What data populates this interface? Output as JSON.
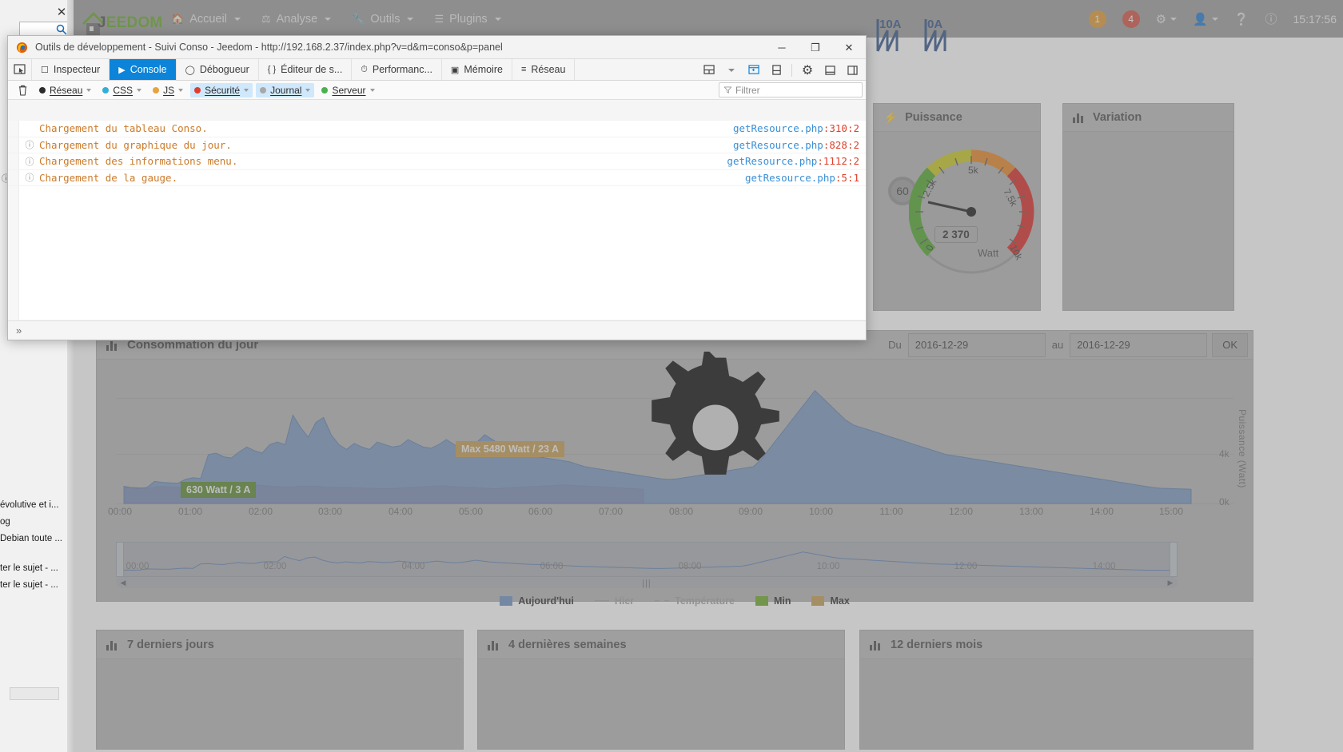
{
  "browser_left": {
    "tab_close_icon": "close-icon",
    "search_icon": "search-icon",
    "links": [
      "évolutive et i...",
      "og",
      "Debian toute ...",
      "",
      "ter le sujet - ...",
      "ter le sujet - ..."
    ]
  },
  "jeedom": {
    "logo": {
      "name": "jeedom-logo",
      "word1": "J",
      "word2": "EEDOM"
    },
    "nav": [
      {
        "label": "Accueil",
        "icon": "home-icon"
      },
      {
        "label": "Analyse",
        "icon": "analysis-icon"
      },
      {
        "label": "Outils",
        "icon": "wrench-icon"
      },
      {
        "label": "Plugins",
        "icon": "plugins-icon"
      }
    ],
    "nav_right": {
      "badge_orange": "1",
      "badge_red": "4",
      "gear_icon": "gear-icon",
      "user_icon": "user-icon",
      "help_icon": "question-icon",
      "info_icon": "info-icon",
      "clock": "15:17:56"
    },
    "breakers": [
      {
        "label": "10A",
        "name": "breaker-10a"
      },
      {
        "label": "0A",
        "name": "breaker-0a"
      }
    ],
    "widgets": [
      {
        "title": "Puissance",
        "icon": "bolt-icon"
      },
      {
        "title": "Variation",
        "icon": "chart-icon"
      }
    ],
    "gauge": {
      "badge": "60",
      "value": "2 370",
      "unit": "Watt",
      "ticks": [
        "0",
        "2.5k",
        "5k",
        "7.5k",
        "10k"
      ]
    },
    "conso_panel": {
      "title": "Consommation du jour",
      "icon": "chart-icon",
      "date_from_label": "Du",
      "date_from_value": "2016-12-29",
      "date_to_label": "au",
      "date_to_value": "2016-12-29",
      "ok_label": "OK"
    },
    "bottom_cards": [
      {
        "title": "7 derniers jours",
        "icon": "chart-icon"
      },
      {
        "title": "4 dernières semaines",
        "icon": "chart-icon"
      },
      {
        "title": "12 derniers mois",
        "icon": "chart-icon"
      }
    ],
    "gear_overlay_icon": "gear-icon"
  },
  "chart_data": {
    "type": "area",
    "title": "Consommation du jour",
    "xlabel": "",
    "ylabel": "Puissance (Watt)",
    "ylim": [
      0,
      5000
    ],
    "yticks": [
      0,
      4000
    ],
    "ytick_labels": [
      "0k",
      "4k"
    ],
    "xticks": [
      "00:00",
      "01:00",
      "02:00",
      "03:00",
      "04:00",
      "05:00",
      "06:00",
      "07:00",
      "08:00",
      "09:00",
      "10:00",
      "11:00",
      "12:00",
      "13:00",
      "14:00",
      "15:00"
    ],
    "grid": true,
    "legend_position": "bottom",
    "annotations": [
      {
        "name": "max-label",
        "text": "Max 5480 Watt / 23 A",
        "color": "#c49a4e"
      },
      {
        "name": "min-label",
        "text": "630 Watt / 3 A",
        "color": "#56862a"
      }
    ],
    "legend": [
      {
        "label": "Aujourd'hui",
        "marker": "swatch",
        "color": "#6c8ebf"
      },
      {
        "label": "Hier",
        "marker": "line",
        "color": "#9e9e9e"
      },
      {
        "label": "Température",
        "marker": "dash",
        "color": "#9e9e9e"
      },
      {
        "label": "Min",
        "marker": "swatch",
        "color": "#6aa621"
      },
      {
        "label": "Max",
        "marker": "swatch",
        "color": "#c49a4e"
      }
    ],
    "series": [
      {
        "name": "Aujourd'hui",
        "color": "#6c8ebf",
        "values": [
          700,
          640,
          620,
          650,
          900,
          860,
          840,
          820,
          980,
          1050,
          1020,
          1990,
          2050,
          1900,
          1850,
          2100,
          2300,
          2150,
          2050,
          2400,
          2500,
          2400,
          3600,
          3100,
          2700,
          3300,
          3500,
          2800,
          2400,
          2200,
          2450,
          2300,
          2200,
          2500,
          2400,
          2300,
          2350,
          2600,
          2450,
          2300,
          2250,
          2400,
          2600,
          2400,
          2250,
          2300,
          2500,
          2800,
          2600,
          2400,
          2300,
          2200,
          2100,
          2000,
          1900,
          1850,
          1800,
          1750,
          1700,
          1600,
          1500,
          1450,
          1400,
          1350,
          1300,
          1250,
          1200,
          1150,
          1100,
          1050,
          1000,
          980,
          1000,
          1050,
          1100,
          1150,
          1200,
          1250,
          1300,
          1350,
          1400,
          1450,
          1500,
          1800,
          2200,
          2600,
          3000,
          3400,
          3800,
          4200,
          4600,
          4300,
          4000,
          3700,
          3400,
          3200,
          3100,
          3000,
          2900,
          2800,
          2700,
          2600,
          2500,
          2400,
          2300,
          2200,
          2100,
          2000,
          1950,
          1900,
          1850,
          1800,
          1750,
          1700,
          1650,
          1600,
          1550,
          1500,
          1450,
          1400,
          1350,
          1300,
          1250,
          1200,
          1150,
          1100,
          1050,
          1000,
          950,
          900,
          850,
          800,
          750,
          700,
          650,
          620,
          610,
          600,
          590,
          580
        ]
      },
      {
        "name": "Hier",
        "color": "#a5504e",
        "values": [
          650,
          640,
          630,
          620,
          700,
          680,
          660,
          650,
          640,
          630,
          700,
          720,
          690,
          660,
          700,
          750,
          720,
          700,
          680,
          660,
          700,
          710,
          690,
          670,
          660,
          650,
          640,
          630,
          620,
          610,
          600,
          620,
          640,
          660,
          680,
          700,
          720,
          700,
          680,
          660,
          640,
          620,
          600,
          620,
          640,
          660,
          680,
          700,
          720,
          740,
          760,
          740,
          720,
          700,
          680,
          660,
          640,
          620,
          600,
          580
        ]
      }
    ],
    "navigator": {
      "xticks": [
        "00:00",
        "02:00",
        "04:00",
        "06:00",
        "08:00",
        "10:00",
        "12:00",
        "14:00"
      ]
    }
  },
  "devtools": {
    "window": {
      "title": "Outils de développement - Suivi Conso - Jeedom - http://192.168.2.37/index.php?v=d&m=conso&p=panel",
      "firefox_icon": "firefox-icon",
      "minimize_label": "─",
      "maximize_label": "❐",
      "close_label": "✕"
    },
    "picker_icon": "element-picker-icon",
    "tabs": [
      {
        "label": "Inspecteur",
        "icon": "inspector-icon",
        "active": false
      },
      {
        "label": "Console",
        "icon": "console-icon",
        "active": true
      },
      {
        "label": "Débogueur",
        "icon": "debugger-icon",
        "active": false
      },
      {
        "label": "Éditeur de s...",
        "icon": "style-editor-icon",
        "active": false
      },
      {
        "label": "Performanc...",
        "icon": "performance-icon",
        "active": false
      },
      {
        "label": "Mémoire",
        "icon": "memory-icon",
        "active": false
      },
      {
        "label": "Réseau",
        "icon": "network-icon",
        "active": false
      }
    ],
    "tools": [
      {
        "name": "split-console-icon",
        "on": false
      },
      {
        "name": "responsive-design-icon",
        "on": true
      },
      {
        "name": "dock-bottom-icon",
        "on": false
      },
      {
        "name": "settings-gear-icon",
        "on": false
      },
      {
        "name": "dock-window-icon",
        "on": false
      },
      {
        "name": "dock-side-icon",
        "on": false
      }
    ],
    "filters": {
      "trash_icon": "trash-icon",
      "chips": [
        {
          "label": "Réseau",
          "color": "#2b2b2b",
          "selected": false
        },
        {
          "label": "CSS",
          "color": "#31b0d5",
          "selected": false
        },
        {
          "label": "JS",
          "color": "#e8a33d",
          "selected": false
        },
        {
          "label": "Sécurité",
          "color": "#e23c2e",
          "selected": true
        },
        {
          "label": "Journal",
          "color": "#a8a8a8",
          "selected": true
        },
        {
          "label": "Serveur",
          "color": "#4caf50",
          "selected": false
        }
      ],
      "input_placeholder": "Filtrer",
      "filter_icon": "funnel-icon"
    },
    "messages": [
      {
        "icon": "",
        "text": "Chargement du tableau Conso.",
        "link": "getResource.php",
        "line": ":310:2"
      },
      {
        "icon": "info-icon",
        "text": "Chargement du graphique du jour.",
        "link": "getResource.php",
        "line": ":828:2"
      },
      {
        "icon": "info-icon",
        "text": "Chargement des informations menu.",
        "link": "getResource.php",
        "line": ":1112:2"
      },
      {
        "icon": "info-icon",
        "text": "Chargement de la gauge.",
        "link": "getResource.php",
        "line": ":5:1"
      }
    ],
    "prompt": "»"
  }
}
